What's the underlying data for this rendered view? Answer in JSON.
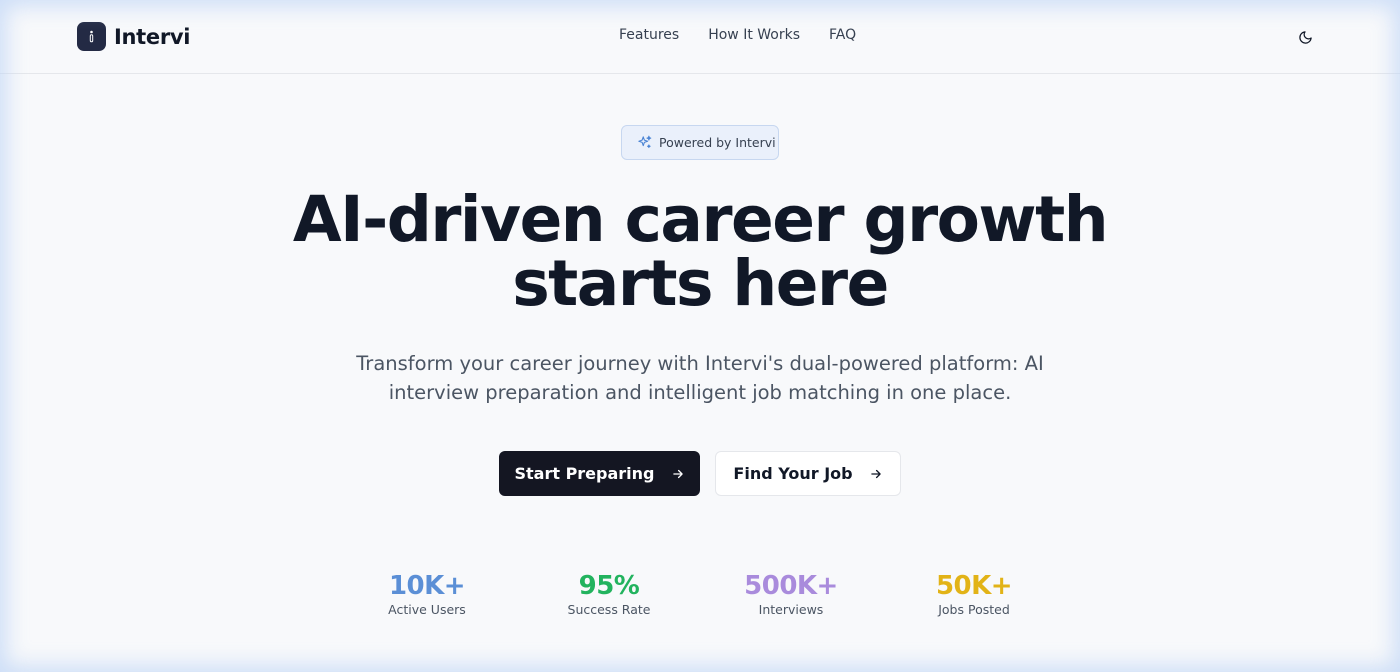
{
  "brand": {
    "name": "Intervi",
    "logo_icon": "logo-mark-icon"
  },
  "nav": {
    "links": [
      {
        "label": "Features"
      },
      {
        "label": "How It Works"
      },
      {
        "label": "FAQ"
      }
    ],
    "theme_toggle_icon": "moon-icon"
  },
  "hero": {
    "badge": {
      "icon": "sparkles-icon",
      "text": "Powered by Intervi"
    },
    "headline": {
      "line1": "AI-driven career growth",
      "line2": "starts here"
    },
    "subtitle": "Transform your career journey with Intervi's dual-powered platform: AI interview preparation and intelligent job matching in one place.",
    "primary_button": {
      "label": "Start Preparing",
      "icon": "arrow-right-icon"
    },
    "secondary_button": {
      "label": "Find Your Job",
      "icon": "arrow-right-icon"
    }
  },
  "stats": [
    {
      "value": "10K+",
      "label": "Active Users",
      "color": "#5b8fd6"
    },
    {
      "value": "95%",
      "label": "Success Rate",
      "color": "#22b35e"
    },
    {
      "value": "500K+",
      "label": "Interviews",
      "color": "#a98bdc"
    },
    {
      "value": "50K+",
      "label": "Jobs Posted",
      "color": "#e2b317"
    }
  ],
  "colors": {
    "background": "#f8f9fb",
    "primary_button_bg": "#141622",
    "badge_bg": "#eaf0fb",
    "badge_border": "#c7d7f0",
    "logo_bg": "#232a44"
  }
}
